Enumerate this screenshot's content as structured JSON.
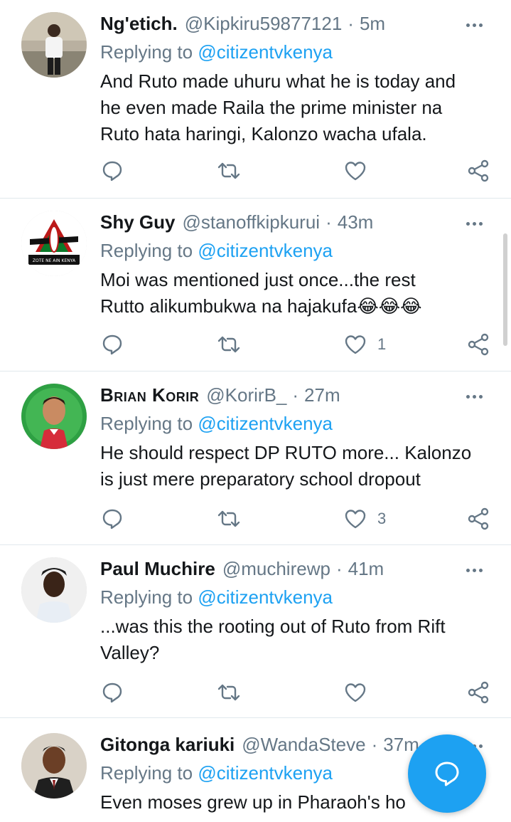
{
  "tweets": [
    {
      "name": "Ng'etich.",
      "handle": "@Kipkiru59877121",
      "time": "5m",
      "replying_prefix": "Replying to",
      "replying_to": "@citizentvkenya",
      "text_lines": [
        "And Ruto made uhuru what he is today and",
        "he even made Raila the prime minister na",
        "Ruto hata haringi, Kalonzo wacha ufala."
      ],
      "reply_count": "",
      "retweet_count": "",
      "like_count": ""
    },
    {
      "name": "Shy Guy",
      "handle": "@stanoffkipkurui",
      "time": "43m",
      "replying_prefix": "Replying to",
      "replying_to": "@citizentvkenya",
      "text_lines": [
        "Moi was mentioned just once...the rest",
        "Rutto alikumbukwa na hajakufa😂😂😂"
      ],
      "reply_count": "",
      "retweet_count": "",
      "like_count": "1"
    },
    {
      "name": "Brian Korir",
      "handle": "@KorirB_",
      "time": "27m",
      "replying_prefix": "Replying to",
      "replying_to": "@citizentvkenya",
      "text_lines": [
        "He should respect DP RUTO more... Kalonzo",
        "is just mere preparatory school dropout"
      ],
      "reply_count": "",
      "retweet_count": "",
      "like_count": "3"
    },
    {
      "name": "Paul Muchire",
      "handle": "@muchirewp",
      "time": "41m",
      "replying_prefix": "Replying to",
      "replying_to": "@citizentvkenya",
      "text_lines": [
        "...was this the rooting out of Ruto from Rift",
        "Valley?"
      ],
      "reply_count": "",
      "retweet_count": "",
      "like_count": ""
    },
    {
      "name": "Gitonga kariuki",
      "handle": "@WandaSteve",
      "time": "37m",
      "replying_prefix": "Replying to",
      "replying_to": "@citizentvkenya",
      "text_lines": [
        "Even moses grew up in Pharaoh's ho"
      ],
      "reply_count": "",
      "retweet_count": "",
      "like_count": ""
    }
  ],
  "avatar_banner_text": "ZOTE NE AIN KENYA",
  "colors": {
    "accent": "#1da1f2",
    "secondary_text": "#657786",
    "primary_text": "#14171a",
    "divider": "#e1e8ed"
  },
  "icons": {
    "reply": "reply-icon",
    "retweet": "retweet-icon",
    "like": "heart-icon",
    "share": "share-icon",
    "more": "more-icon",
    "compose": "compose-reply-icon"
  }
}
